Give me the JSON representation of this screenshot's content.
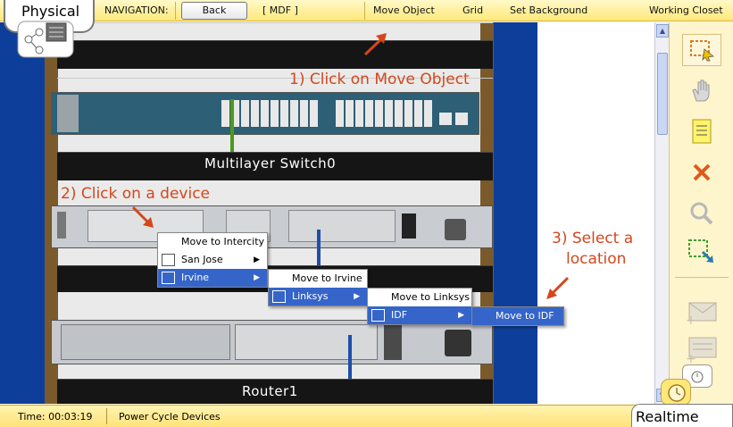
{
  "topbar": {
    "mode_tab": "Physical",
    "navigation_label": "NAVIGATION:",
    "back_button": "Back",
    "location_crumb": "[ MDF ]",
    "move_object": "Move Object",
    "grid": "Grid",
    "set_background": "Set Background",
    "current_location": "Working Closet"
  },
  "rack": {
    "devices": [
      {
        "label": "Multilayer Switch0"
      },
      {
        "label": "Router1"
      }
    ]
  },
  "annotations": {
    "step1": "1) Click on Move Object",
    "step2": "2) Click on a device",
    "step3_line1": "3) Select a",
    "step3_line2": "location"
  },
  "context_menu": {
    "level1": [
      "Move to Intercity",
      "San Jose",
      "Irvine"
    ],
    "level2": [
      "Move to Irvine",
      "Linksys"
    ],
    "level3": [
      "Move to Linksys",
      "IDF"
    ],
    "level4": [
      "Move to IDF"
    ]
  },
  "statusbar": {
    "time": "Time: 00:03:19",
    "power_cycle": "Power Cycle Devices",
    "realtime_tab": "Realtime"
  },
  "colors": {
    "accent": "#3565c8",
    "annotation": "#d4471c",
    "rack_background": "#0d3f9a",
    "toolbar": "#fff5cc"
  },
  "icons": [
    "physical-mode-icon",
    "select-icon",
    "hand-icon",
    "note-icon",
    "delete-icon",
    "zoom-icon",
    "resize-icon",
    "simple-pdu-icon",
    "complex-pdu-icon",
    "realtime-clock-icon"
  ]
}
